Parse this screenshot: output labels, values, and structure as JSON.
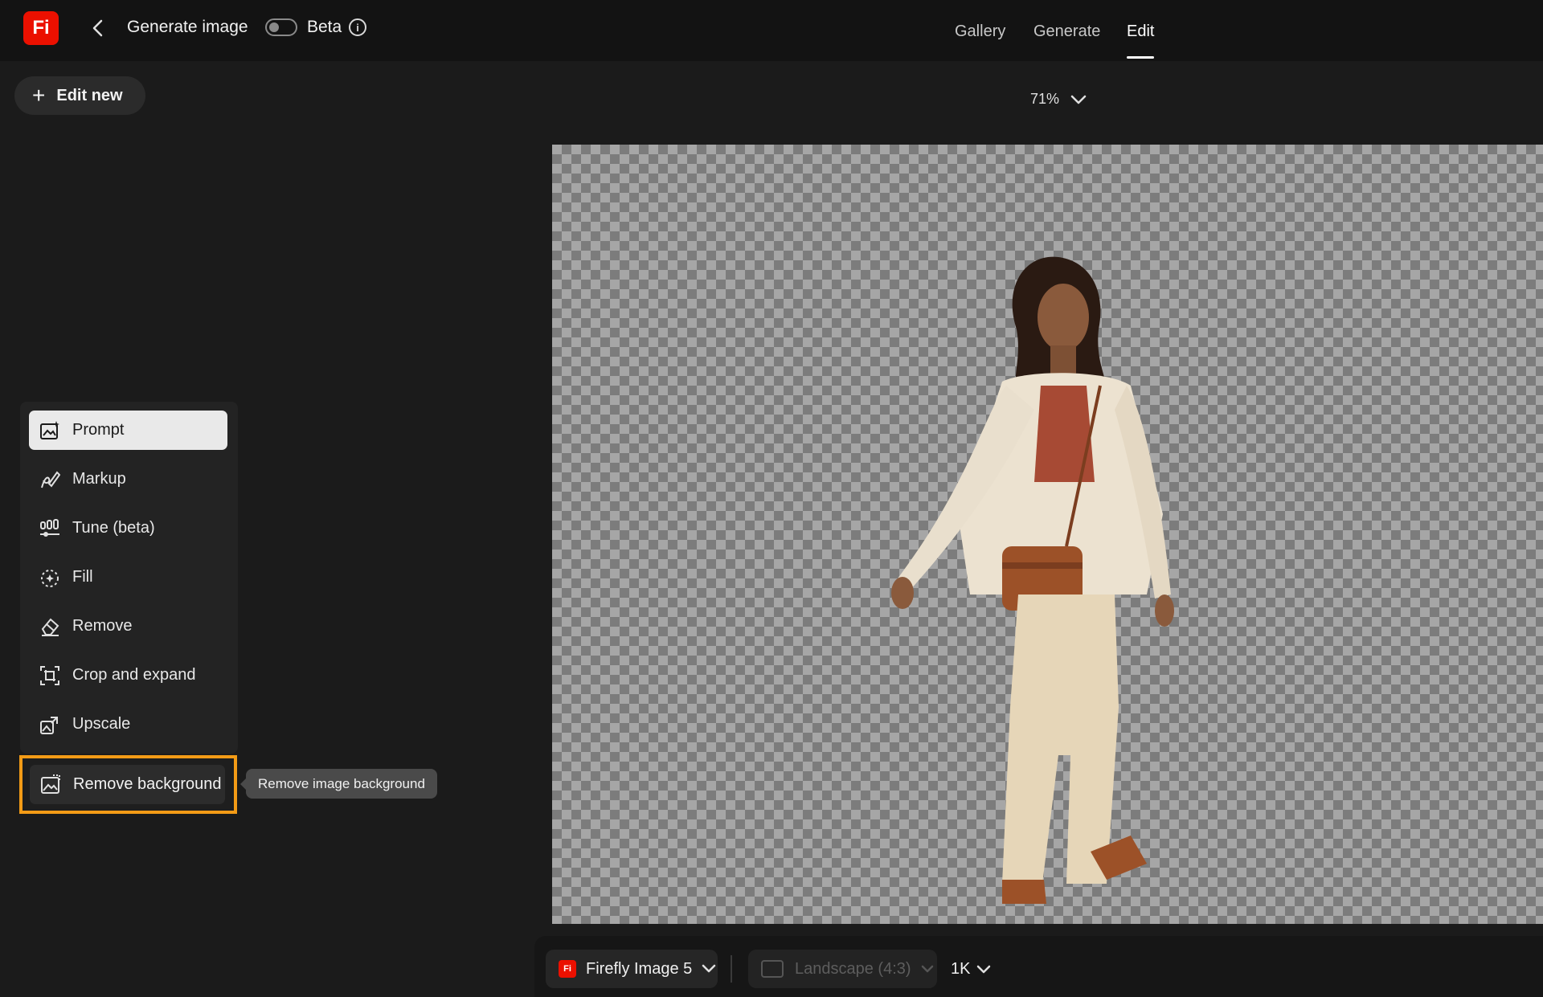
{
  "header": {
    "app_logo": "Fi",
    "title": "Generate image",
    "beta_label": "Beta",
    "nav": [
      {
        "label": "Gallery",
        "active": false
      },
      {
        "label": "Generate",
        "active": false
      },
      {
        "label": "Edit",
        "active": true
      }
    ]
  },
  "toolbar": {
    "edit_new_label": "Edit new",
    "zoom_value": "71%"
  },
  "tools": [
    {
      "label": "Prompt",
      "icon": "prompt-icon",
      "selected": true
    },
    {
      "label": "Markup",
      "icon": "markup-icon",
      "selected": false
    },
    {
      "label": "Tune (beta)",
      "icon": "tune-icon",
      "selected": false
    },
    {
      "label": "Fill",
      "icon": "fill-icon",
      "selected": false
    },
    {
      "label": "Remove",
      "icon": "remove-icon",
      "selected": false
    },
    {
      "label": "Crop and expand",
      "icon": "crop-icon",
      "selected": false
    },
    {
      "label": "Upscale",
      "icon": "upscale-icon",
      "selected": false
    }
  ],
  "remove_background": {
    "label": "Remove background",
    "tooltip": "Remove image background",
    "highlight_color": "#f39b16"
  },
  "bottom_bar": {
    "model_logo": "Fi",
    "model_label": "Firefly Image 5",
    "aspect_label": "Landscape (4:3)",
    "resolution_label": "1K"
  },
  "colors": {
    "brand_red": "#eb1000",
    "background": "#1b1b1b"
  }
}
